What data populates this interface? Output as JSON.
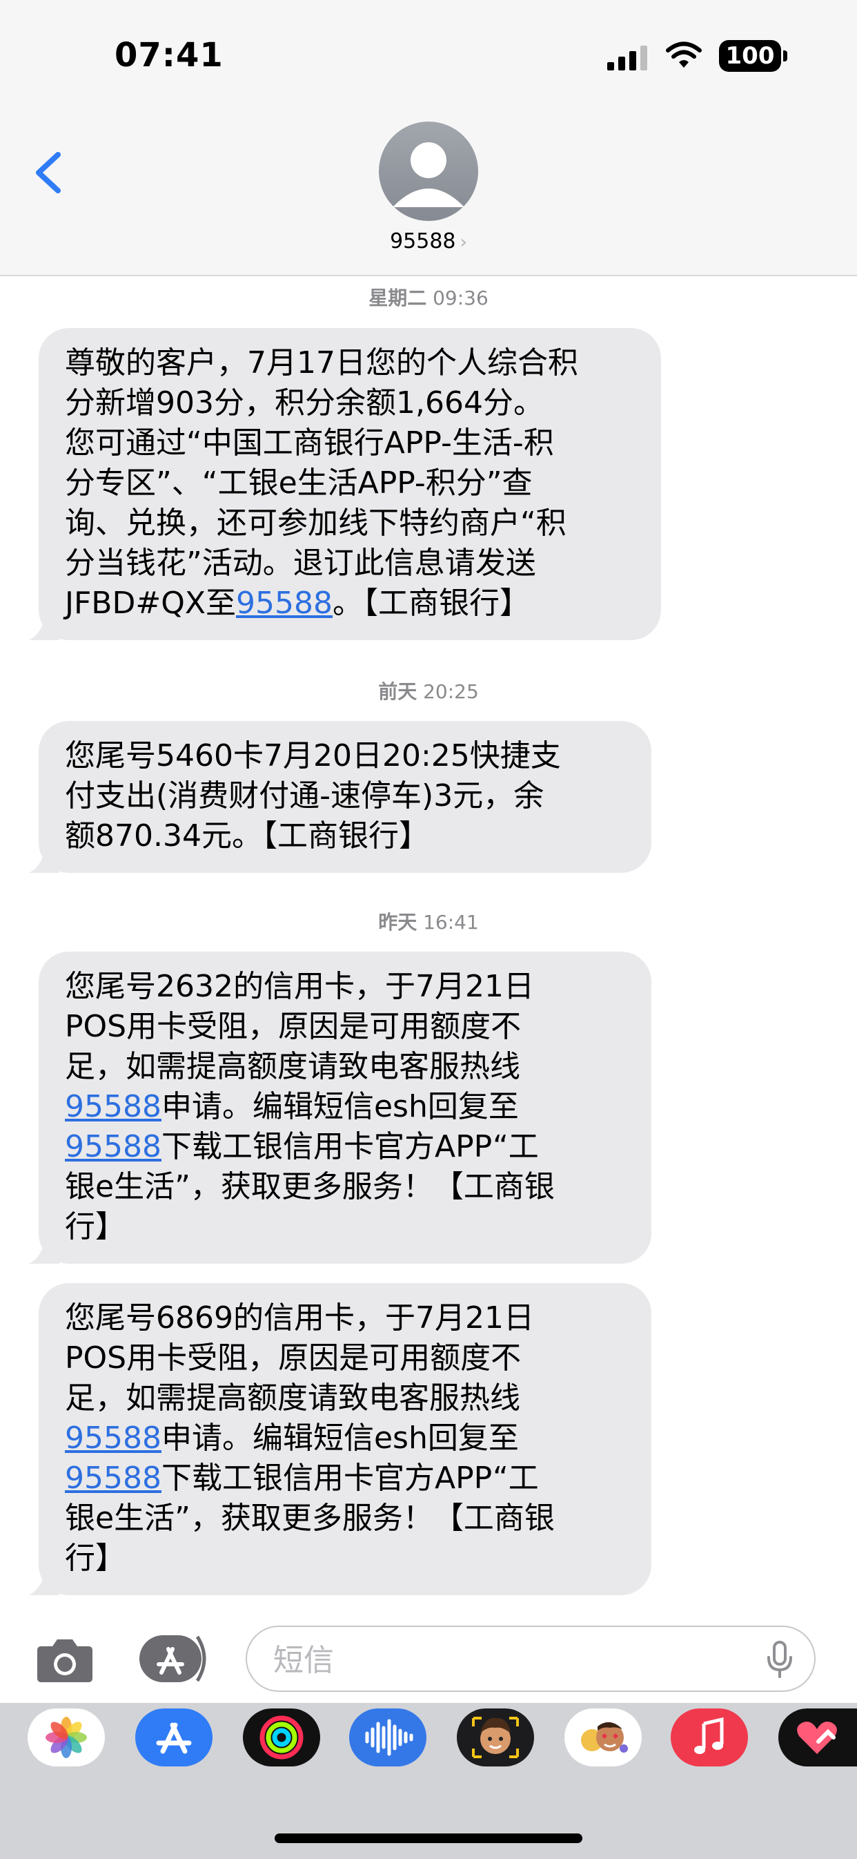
{
  "status_bar": {
    "time": "07:41",
    "battery": "100"
  },
  "header": {
    "contact": "95588"
  },
  "thread": [
    {
      "timestamp": {
        "day": "星期二",
        "time": "09:36"
      },
      "messages": [
        {
          "lines": [
            [
              {
                "t": "尊敬的客户，7月17日您的个人综合积"
              }
            ],
            [
              {
                "t": "分新增903分，积分余额1,664分。"
              }
            ],
            [
              {
                "t": "您可通过“中国工商银行APP-生活-积"
              }
            ],
            [
              {
                "t": "分专区”、“工银e生活APP-积分”查"
              }
            ],
            [
              {
                "t": "询、兑换，还可参加线下特约商户“积"
              }
            ],
            [
              {
                "t": "分当钱花”活动。退订此信息请发送"
              }
            ],
            [
              {
                "t": "JFBD#QX至"
              },
              {
                "t": "95588",
                "link": true
              },
              {
                "t": "。【工商银行】"
              }
            ]
          ]
        }
      ]
    },
    {
      "timestamp": {
        "day": "前天",
        "time": "20:25"
      },
      "messages": [
        {
          "lines": [
            [
              {
                "t": "您尾号5460卡7月20日20:25快捷支"
              }
            ],
            [
              {
                "t": "付支出(消费财付通-速停车)3元，余"
              }
            ],
            [
              {
                "t": "额870.34元。【工商银行】"
              }
            ]
          ]
        }
      ]
    },
    {
      "timestamp": {
        "day": "昨天",
        "time": "16:41"
      },
      "messages": [
        {
          "lines": [
            [
              {
                "t": "您尾号2632的信用卡，于7月21日"
              }
            ],
            [
              {
                "t": "POS用卡受阻，原因是可用额度不"
              }
            ],
            [
              {
                "t": "足，如需提高额度请致电客服热线"
              }
            ],
            [
              {
                "t": "95588",
                "link": true
              },
              {
                "t": "申请。编辑短信esh回复至"
              }
            ],
            [
              {
                "t": "95588",
                "link": true
              },
              {
                "t": "下载工银信用卡官方APP“工"
              }
            ],
            [
              {
                "t": "银e生活”，获取更多服务！【工商银"
              }
            ],
            [
              {
                "t": "行】"
              }
            ]
          ]
        },
        {
          "lines": [
            [
              {
                "t": "您尾号6869的信用卡，于7月21日"
              }
            ],
            [
              {
                "t": "POS用卡受阻，原因是可用额度不"
              }
            ],
            [
              {
                "t": "足，如需提高额度请致电客服热线"
              }
            ],
            [
              {
                "t": "95588",
                "link": true
              },
              {
                "t": "申请。编辑短信esh回复至"
              }
            ],
            [
              {
                "t": "95588",
                "link": true
              },
              {
                "t": "下载工银信用卡官方APP“工"
              }
            ],
            [
              {
                "t": "银e生活”，获取更多服务！【工商银"
              }
            ],
            [
              {
                "t": "行】"
              }
            ]
          ]
        }
      ]
    }
  ],
  "composer": {
    "placeholder": "短信"
  },
  "app_drawer": [
    "photos-icon",
    "app-store-icon",
    "activity-icon",
    "audio-message-icon",
    "memoji-icon",
    "memoji-stickers-icon",
    "music-icon",
    "heart-digital-touch-icon"
  ],
  "colors": {
    "bubble": "#e9e9eb",
    "link": "#2d6fe0",
    "accent": "#2f7cf6"
  }
}
